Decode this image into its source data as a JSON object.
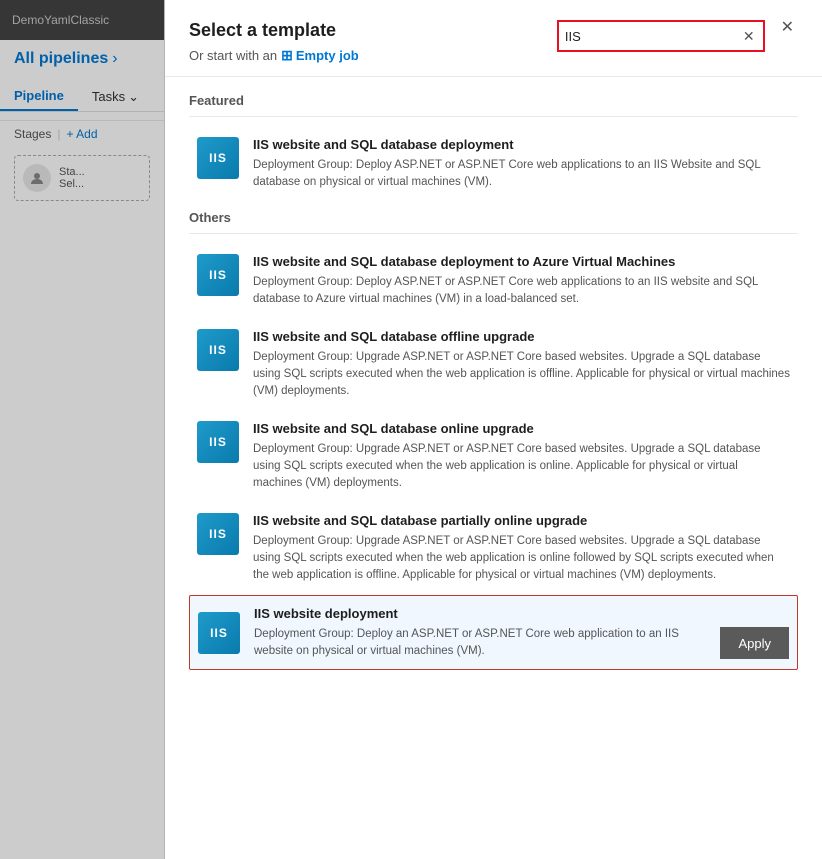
{
  "sidebar": {
    "app_name": "DemoYamlClassic",
    "breadcrumb": "All pipelines",
    "breadcrumb_chevron": "›",
    "nav_items": [
      {
        "label": "Pipeline",
        "active": true
      },
      {
        "label": "Tasks",
        "dropdown": true
      }
    ],
    "stages_label": "Stages",
    "add_label": "+ Add",
    "stage_card": {
      "label": "Sta...",
      "sub": "Sel..."
    }
  },
  "modal": {
    "title": "Select a template",
    "subtitle_prefix": "Or start with an",
    "empty_job_label": "Empty job",
    "search_placeholder": "IIS",
    "search_value": "IIS",
    "close_icon": "✕",
    "clear_icon": "✕",
    "sections": [
      {
        "label": "Featured",
        "items": [
          {
            "badge": "IIS",
            "name": "IIS website and SQL database deployment",
            "desc": "Deployment Group: Deploy ASP.NET or ASP.NET Core web applications to an IIS Website and SQL database on physical or virtual machines (VM)."
          }
        ]
      },
      {
        "label": "Others",
        "items": [
          {
            "badge": "IIS",
            "name": "IIS website and SQL database deployment to Azure Virtual Machines",
            "desc": "Deployment Group: Deploy ASP.NET or ASP.NET Core web applications to an IIS website and SQL database to Azure virtual machines (VM) in a load-balanced set."
          },
          {
            "badge": "IIS",
            "name": "IIS website and SQL database offline upgrade",
            "desc": "Deployment Group: Upgrade ASP.NET or ASP.NET Core based websites. Upgrade a SQL database using SQL scripts executed when the web application is offline. Applicable for physical or virtual machines (VM) deployments."
          },
          {
            "badge": "IIS",
            "name": "IIS website and SQL database online upgrade",
            "desc": "Deployment Group: Upgrade ASP.NET or ASP.NET Core based websites. Upgrade a SQL database using SQL scripts executed when the web application is online. Applicable for physical or virtual machines (VM) deployments."
          },
          {
            "badge": "IIS",
            "name": "IIS website and SQL database partially online upgrade",
            "desc": "Deployment Group: Upgrade ASP.NET or ASP.NET Core based websites. Upgrade a SQL database using SQL scripts executed when the web application is online followed by SQL scripts executed when the web application is offline. Applicable for physical or virtual machines (VM) deployments."
          },
          {
            "badge": "IIS",
            "name": "IIS website deployment",
            "desc": "Deployment Group: Deploy an ASP.NET or ASP.NET Core web application to an IIS website on physical or virtual machines (VM).",
            "selected": true
          }
        ]
      }
    ],
    "apply_label": "Apply"
  }
}
